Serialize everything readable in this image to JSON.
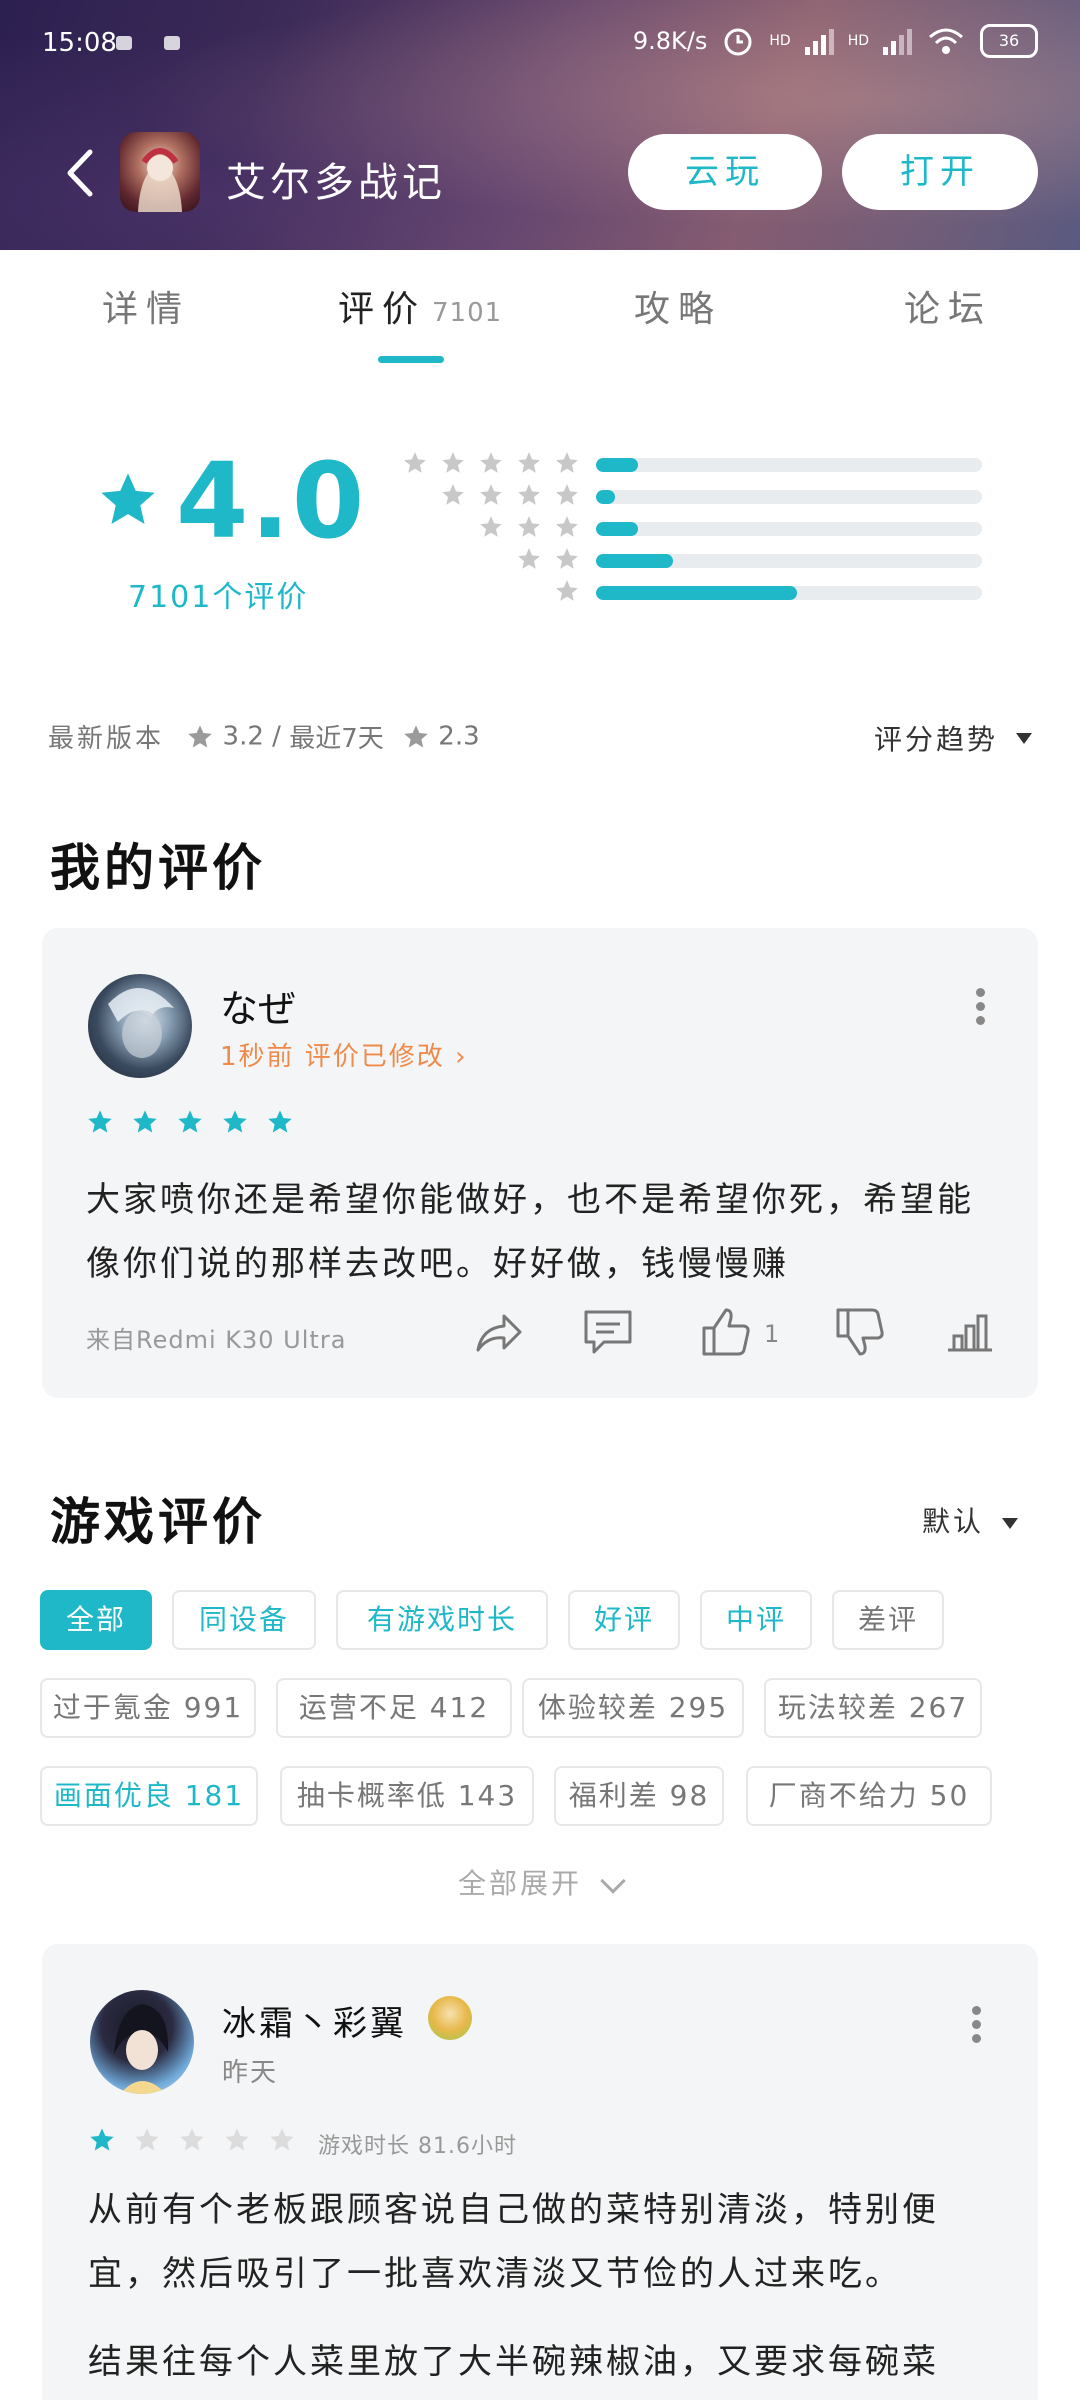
{
  "status_bar": {
    "time": "15:08",
    "net_speed": "9.8K/s",
    "signal_label_1": "HD",
    "signal_label_2": "HD",
    "battery": "36"
  },
  "header": {
    "app_title": "艾尔多战记",
    "cloud_play_label": "云玩",
    "open_label": "打开"
  },
  "tabs": [
    {
      "label": "详情"
    },
    {
      "label": "评价",
      "count": "7101"
    },
    {
      "label": "攻略"
    },
    {
      "label": "论坛"
    }
  ],
  "rating": {
    "score": "4.0",
    "count_label": "7101个评价",
    "distribution": [
      {
        "stars": 5,
        "fraction": 0.11
      },
      {
        "stars": 4,
        "fraction": 0.05
      },
      {
        "stars": 3,
        "fraction": 0.11
      },
      {
        "stars": 2,
        "fraction": 0.2
      },
      {
        "stars": 1,
        "fraction": 0.52
      }
    ]
  },
  "version_info": {
    "latest_label": "最新版本",
    "latest_score": "3.2",
    "separator": "/",
    "recent_label": "最近7天",
    "recent_score": "2.3",
    "trend_label": "评分趋势"
  },
  "my_review": {
    "section_title": "我的评价",
    "user_name": "なぜ",
    "edit_note": "1秒前 评价已修改 ›",
    "stars": 5,
    "text": "大家喷你还是希望你能做好，也不是希望你死，希望能像你们说的那样去改吧。好好做，钱慢慢赚",
    "device": "来自Redmi K30 Ultra",
    "like_count": "1"
  },
  "game_reviews": {
    "section_title": "游戏评价",
    "sort_label": "默认",
    "filters_row1": [
      "全部",
      "同设备",
      "有游戏时长",
      "好评",
      "中评",
      "差评"
    ],
    "filters_row2": [
      "过于氪金 991",
      "运营不足 412",
      "体验较差 295",
      "玩法较差 267"
    ],
    "filters_row3": [
      "画面优良 181",
      "抽卡概率低 143",
      "福利差 98",
      "厂商不给力 50"
    ],
    "expand_label": "全部展开"
  },
  "review_1": {
    "user_name": "冰霜丶彩翼",
    "post_time": "昨天",
    "stars": 1,
    "playtime": "游戏时长 81.6小时",
    "paragraph_1": "从前有个老板跟顾客说自己做的菜特别清淡，特别便宜，然后吸引了一批喜欢清淡又节俭的人过来吃。",
    "paragraph_2": "结果往每个人菜里放了大半碗辣椒油，又要求每碗菜"
  },
  "colors": {
    "accent": "#1fb8c8",
    "edit_note": "#f08a4b",
    "card_bg": "#f4f5f6"
  }
}
